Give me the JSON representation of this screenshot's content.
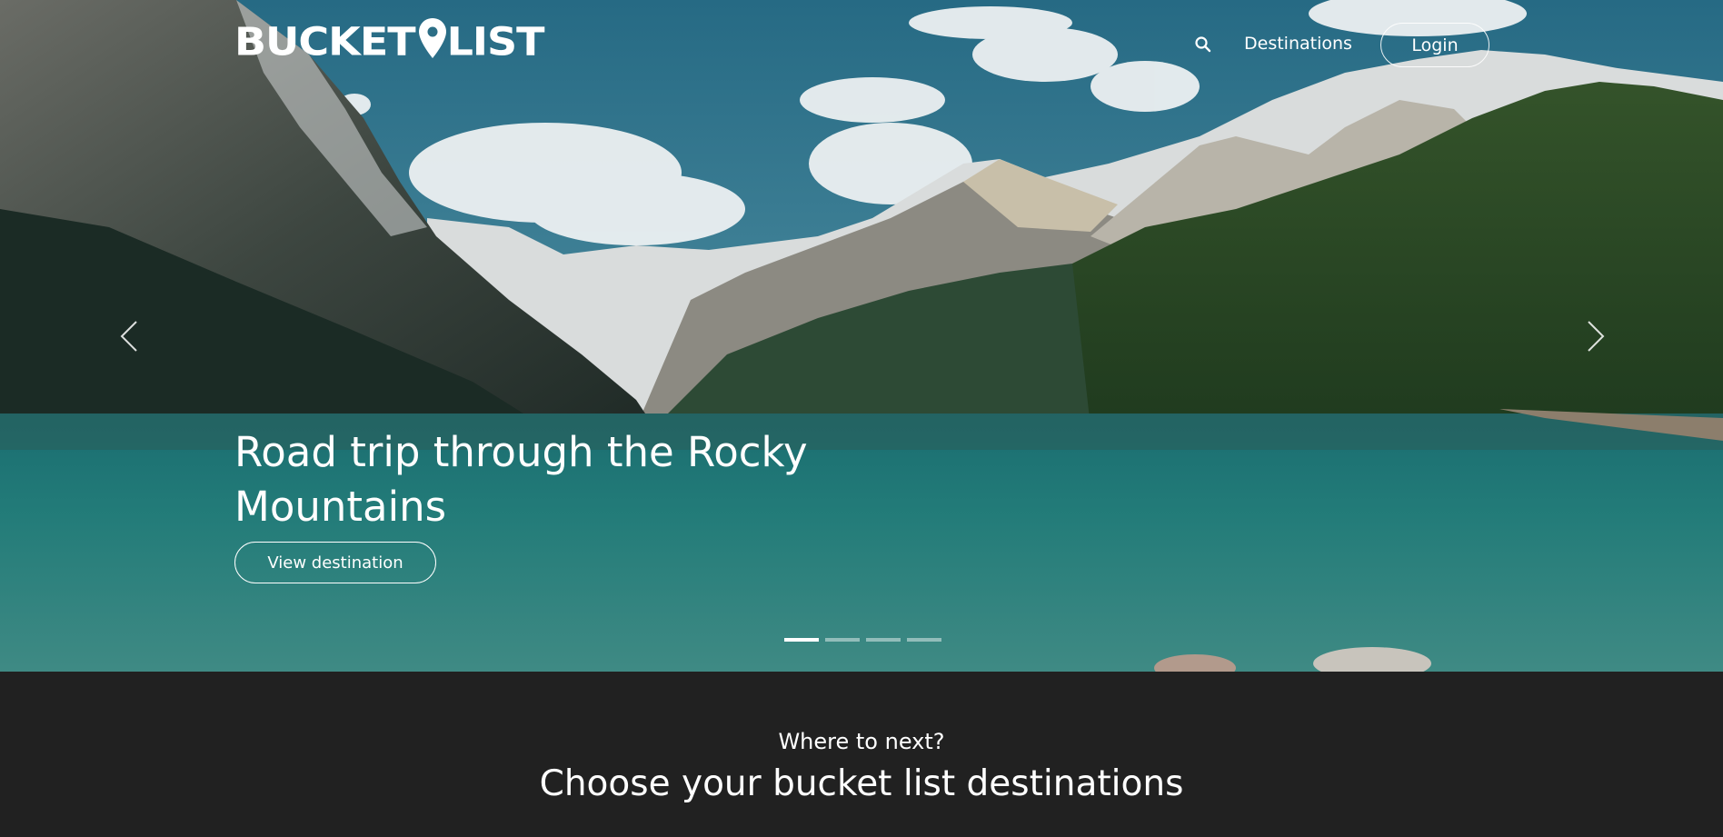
{
  "brand": {
    "name_part1": "BUCKET",
    "name_part2": "LIST"
  },
  "nav": {
    "search_icon": "search-icon",
    "destinations_label": "Destinations",
    "login_label": "Login"
  },
  "carousel": {
    "slide_title": "Road trip through the Rocky Mountains",
    "cta_label": "View destination",
    "prev_icon": "chevron-left-icon",
    "next_icon": "chevron-right-icon",
    "slide_count": 4,
    "active_index": 0
  },
  "section": {
    "subtitle": "Where to next?",
    "title": "Choose your bucket list destinations"
  },
  "colors": {
    "section_bg": "#212121",
    "text": "#ffffff"
  }
}
